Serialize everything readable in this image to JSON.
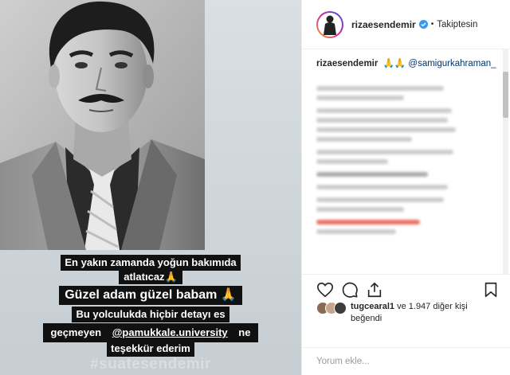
{
  "post": {
    "captions": [
      "En yakın zamanda yoğun bakımıda",
      "atlatıcaz🙏",
      "Güzel adam güzel babam 🙏",
      "Bu yolculukda hiçbir detayı es",
      "geçmeyen",
      "@pamukkale.university",
      "ne",
      "teşekkür ederim",
      "#suatesendemir"
    ]
  },
  "header": {
    "username": "rizaesendemir",
    "separator": "•",
    "follow_state": "Takiptesin",
    "icons": {
      "verified": "verified-badge-icon"
    }
  },
  "caption_comment": {
    "username": "rizaesendemir",
    "emoji": "🙏🙏",
    "mention": "@samigurkahraman_"
  },
  "actions": {
    "icons": [
      "heart-icon",
      "comment-icon",
      "share-icon",
      "bookmark-icon"
    ]
  },
  "likes": {
    "first_liker": "tugcearal1",
    "rest": "ve 1.947 diğer kişi",
    "suffix": "beğendi"
  },
  "comment_box": {
    "placeholder": "Yorum ekle..."
  },
  "colors": {
    "border": "#efefef",
    "text": "#262626",
    "link": "#003569",
    "verified": "#3897f0",
    "caption_bg": "#111111"
  }
}
